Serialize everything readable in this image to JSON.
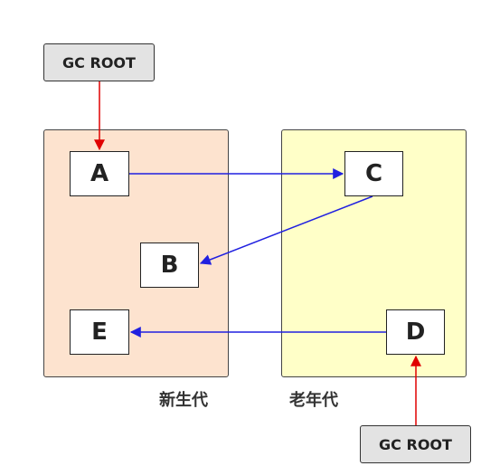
{
  "regions": {
    "young": "新生代",
    "old": "老年代"
  },
  "nodes": {
    "a": "A",
    "b": "B",
    "c": "C",
    "d": "D",
    "e": "E"
  },
  "gc_roots": {
    "top": "GC ROOT",
    "bottom": "GC ROOT"
  },
  "colors": {
    "young_region": "#fde3cf",
    "old_region": "#ffffc8",
    "reference_arrow": "#2020e0",
    "root_arrow": "#e00000",
    "gc_root_box": "#e3e3e3"
  },
  "edges": [
    {
      "from": "GC ROOT",
      "to": "A",
      "kind": "root"
    },
    {
      "from": "A",
      "to": "C",
      "kind": "reference"
    },
    {
      "from": "C",
      "to": "B",
      "kind": "reference"
    },
    {
      "from": "D",
      "to": "E",
      "kind": "reference"
    },
    {
      "from": "GC ROOT",
      "to": "D",
      "kind": "root"
    }
  ]
}
